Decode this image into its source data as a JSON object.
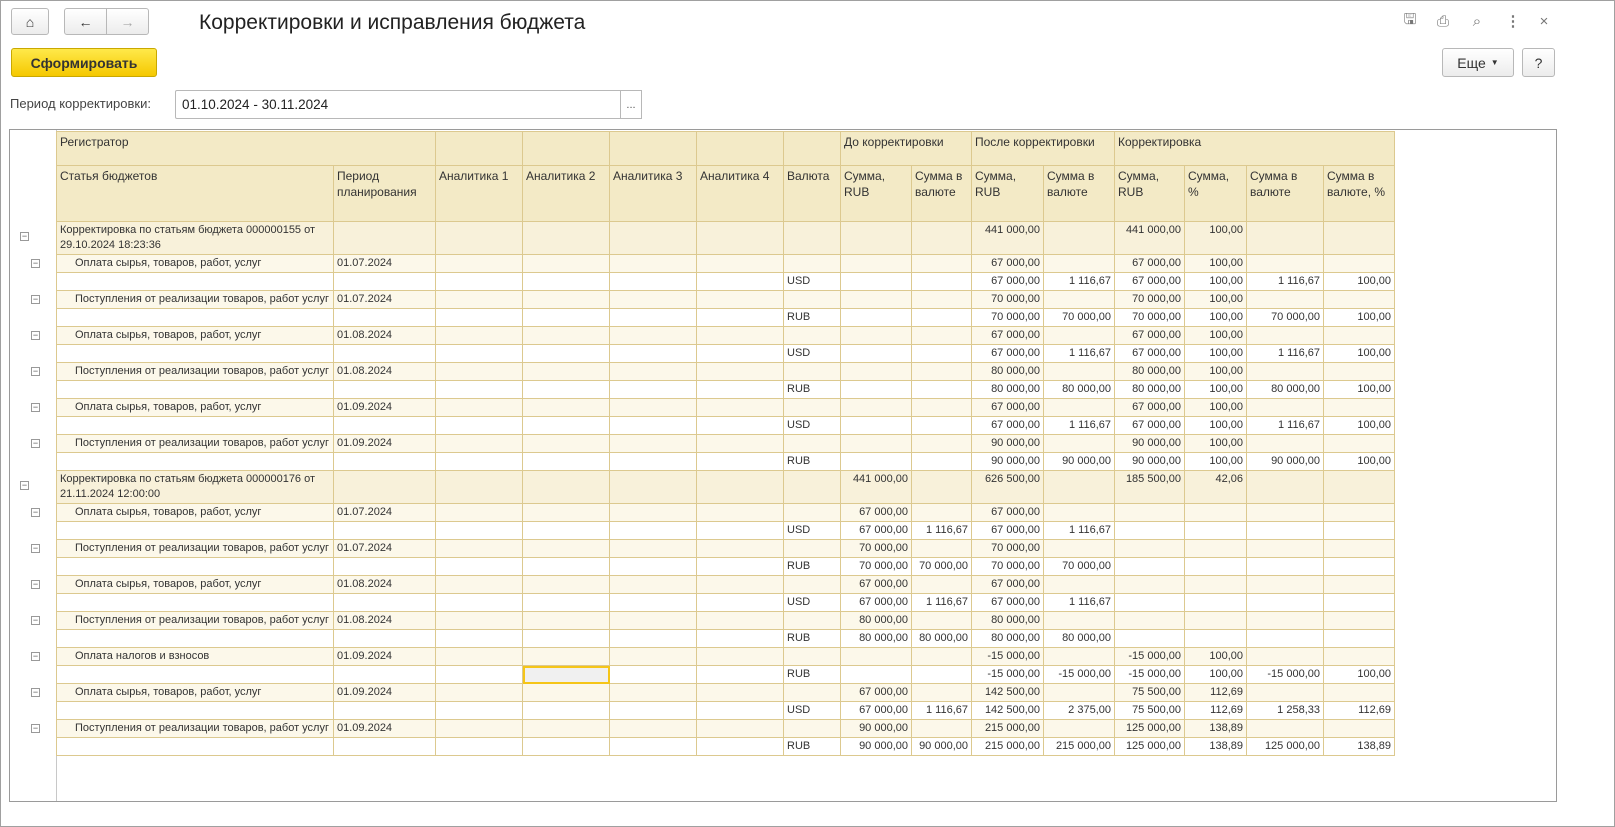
{
  "window": {
    "title": "Корректировки и исправления бюджета"
  },
  "toolbar": {
    "generate_label": "Сформировать",
    "more_label": "Еще",
    "help_label": "?"
  },
  "period": {
    "label": "Период корректировки:",
    "value": "01.10.2024 - 30.11.2024",
    "choose_label": "..."
  },
  "table": {
    "header_top": {
      "registrar": "Регистратор",
      "before": "До корректировки",
      "after": "После корректировки",
      "correction": "Корректировка"
    },
    "columns": [
      "Статья бюджетов",
      "Период планирования",
      "Аналитика 1",
      "Аналитика 2",
      "Аналитика 3",
      "Аналитика 4",
      "Валюта",
      "Сумма, RUB",
      "Сумма в валюте",
      "Сумма, RUB",
      "Сумма в валюте",
      "Сумма, RUB",
      "Сумма, %",
      "Сумма в валюте",
      "Сумма в валюте, %"
    ],
    "rows": [
      {
        "type": "g",
        "label": "Корректировка по статьям бюджета 000000155 от 29.10.2024 18:23:36",
        "period": "",
        "currency": "",
        "values": [
          "",
          "",
          "441 000,00",
          "",
          "441 000,00",
          "100,00",
          "",
          ""
        ]
      },
      {
        "type": "i",
        "label": "Оплата сырья, товаров, работ, услуг",
        "period": "01.07.2024",
        "currency": "",
        "values": [
          "",
          "",
          "67 000,00",
          "",
          "67 000,00",
          "100,00",
          "",
          ""
        ]
      },
      {
        "type": "d",
        "label": "",
        "period": "",
        "currency": "USD",
        "values": [
          "",
          "",
          "67 000,00",
          "1 116,67",
          "67 000,00",
          "100,00",
          "1 116,67",
          "100,00"
        ]
      },
      {
        "type": "i",
        "label": "Поступления от реализации товаров, работ услуг",
        "period": "01.07.2024",
        "currency": "",
        "values": [
          "",
          "",
          "70 000,00",
          "",
          "70 000,00",
          "100,00",
          "",
          ""
        ]
      },
      {
        "type": "d",
        "label": "",
        "period": "",
        "currency": "RUB",
        "values": [
          "",
          "",
          "70 000,00",
          "70 000,00",
          "70 000,00",
          "100,00",
          "70 000,00",
          "100,00"
        ]
      },
      {
        "type": "i",
        "label": "Оплата сырья, товаров, работ, услуг",
        "period": "01.08.2024",
        "currency": "",
        "values": [
          "",
          "",
          "67 000,00",
          "",
          "67 000,00",
          "100,00",
          "",
          ""
        ]
      },
      {
        "type": "d",
        "label": "",
        "period": "",
        "currency": "USD",
        "values": [
          "",
          "",
          "67 000,00",
          "1 116,67",
          "67 000,00",
          "100,00",
          "1 116,67",
          "100,00"
        ]
      },
      {
        "type": "i",
        "label": "Поступления от реализации товаров, работ услуг",
        "period": "01.08.2024",
        "currency": "",
        "values": [
          "",
          "",
          "80 000,00",
          "",
          "80 000,00",
          "100,00",
          "",
          ""
        ]
      },
      {
        "type": "d",
        "label": "",
        "period": "",
        "currency": "RUB",
        "values": [
          "",
          "",
          "80 000,00",
          "80 000,00",
          "80 000,00",
          "100,00",
          "80 000,00",
          "100,00"
        ]
      },
      {
        "type": "i",
        "label": "Оплата сырья, товаров, работ, услуг",
        "period": "01.09.2024",
        "currency": "",
        "values": [
          "",
          "",
          "67 000,00",
          "",
          "67 000,00",
          "100,00",
          "",
          ""
        ]
      },
      {
        "type": "d",
        "label": "",
        "period": "",
        "currency": "USD",
        "values": [
          "",
          "",
          "67 000,00",
          "1 116,67",
          "67 000,00",
          "100,00",
          "1 116,67",
          "100,00"
        ]
      },
      {
        "type": "i",
        "label": "Поступления от реализации товаров, работ услуг",
        "period": "01.09.2024",
        "currency": "",
        "values": [
          "",
          "",
          "90 000,00",
          "",
          "90 000,00",
          "100,00",
          "",
          ""
        ]
      },
      {
        "type": "d",
        "label": "",
        "period": "",
        "currency": "RUB",
        "values": [
          "",
          "",
          "90 000,00",
          "90 000,00",
          "90 000,00",
          "100,00",
          "90 000,00",
          "100,00"
        ]
      },
      {
        "type": "g",
        "label": "Корректировка по статьям бюджета 000000176 от 21.11.2024 12:00:00",
        "period": "",
        "currency": "",
        "values": [
          "441 000,00",
          "",
          "626 500,00",
          "",
          "185 500,00",
          "42,06",
          "",
          ""
        ]
      },
      {
        "type": "i",
        "label": "Оплата сырья, товаров, работ, услуг",
        "period": "01.07.2024",
        "currency": "",
        "values": [
          "67 000,00",
          "",
          "67 000,00",
          "",
          "",
          "",
          "",
          ""
        ]
      },
      {
        "type": "d",
        "label": "",
        "period": "",
        "currency": "USD",
        "values": [
          "67 000,00",
          "1 116,67",
          "67 000,00",
          "1 116,67",
          "",
          "",
          "",
          ""
        ]
      },
      {
        "type": "i",
        "label": "Поступления от реализации товаров, работ услуг",
        "period": "01.07.2024",
        "currency": "",
        "values": [
          "70 000,00",
          "",
          "70 000,00",
          "",
          "",
          "",
          "",
          ""
        ]
      },
      {
        "type": "d",
        "label": "",
        "period": "",
        "currency": "RUB",
        "values": [
          "70 000,00",
          "70 000,00",
          "70 000,00",
          "70 000,00",
          "",
          "",
          "",
          ""
        ]
      },
      {
        "type": "i",
        "label": "Оплата сырья, товаров, работ, услуг",
        "period": "01.08.2024",
        "currency": "",
        "values": [
          "67 000,00",
          "",
          "67 000,00",
          "",
          "",
          "",
          "",
          ""
        ]
      },
      {
        "type": "d",
        "label": "",
        "period": "",
        "currency": "USD",
        "values": [
          "67 000,00",
          "1 116,67",
          "67 000,00",
          "1 116,67",
          "",
          "",
          "",
          ""
        ]
      },
      {
        "type": "i",
        "label": "Поступления от реализации товаров, работ услуг",
        "period": "01.08.2024",
        "currency": "",
        "values": [
          "80 000,00",
          "",
          "80 000,00",
          "",
          "",
          "",
          "",
          ""
        ]
      },
      {
        "type": "d",
        "label": "",
        "period": "",
        "currency": "RUB",
        "values": [
          "80 000,00",
          "80 000,00",
          "80 000,00",
          "80 000,00",
          "",
          "",
          "",
          ""
        ]
      },
      {
        "type": "i",
        "label": "Оплата налогов и взносов",
        "period": "01.09.2024",
        "currency": "",
        "values": [
          "",
          "",
          "-15 000,00",
          "",
          "-15 000,00",
          "100,00",
          "",
          ""
        ]
      },
      {
        "type": "d",
        "label": "",
        "period": "",
        "currency": "RUB",
        "selected": true,
        "values": [
          "",
          "",
          "-15 000,00",
          "-15 000,00",
          "-15 000,00",
          "100,00",
          "-15 000,00",
          "100,00"
        ]
      },
      {
        "type": "i",
        "label": "Оплата сырья, товаров, работ, услуг",
        "period": "01.09.2024",
        "currency": "",
        "values": [
          "67 000,00",
          "",
          "142 500,00",
          "",
          "75 500,00",
          "112,69",
          "",
          ""
        ]
      },
      {
        "type": "d",
        "label": "",
        "period": "",
        "currency": "USD",
        "values": [
          "67 000,00",
          "1 116,67",
          "142 500,00",
          "2 375,00",
          "75 500,00",
          "112,69",
          "1 258,33",
          "112,69"
        ]
      },
      {
        "type": "i",
        "label": "Поступления от реализации товаров, работ услуг",
        "period": "01.09.2024",
        "currency": "",
        "values": [
          "90 000,00",
          "",
          "215 000,00",
          "",
          "125 000,00",
          "138,89",
          "",
          ""
        ]
      },
      {
        "type": "d",
        "label": "",
        "period": "",
        "currency": "RUB",
        "values": [
          "90 000,00",
          "90 000,00",
          "215 000,00",
          "215 000,00",
          "125 000,00",
          "138,89",
          "125 000,00",
          "138,89"
        ]
      }
    ]
  }
}
